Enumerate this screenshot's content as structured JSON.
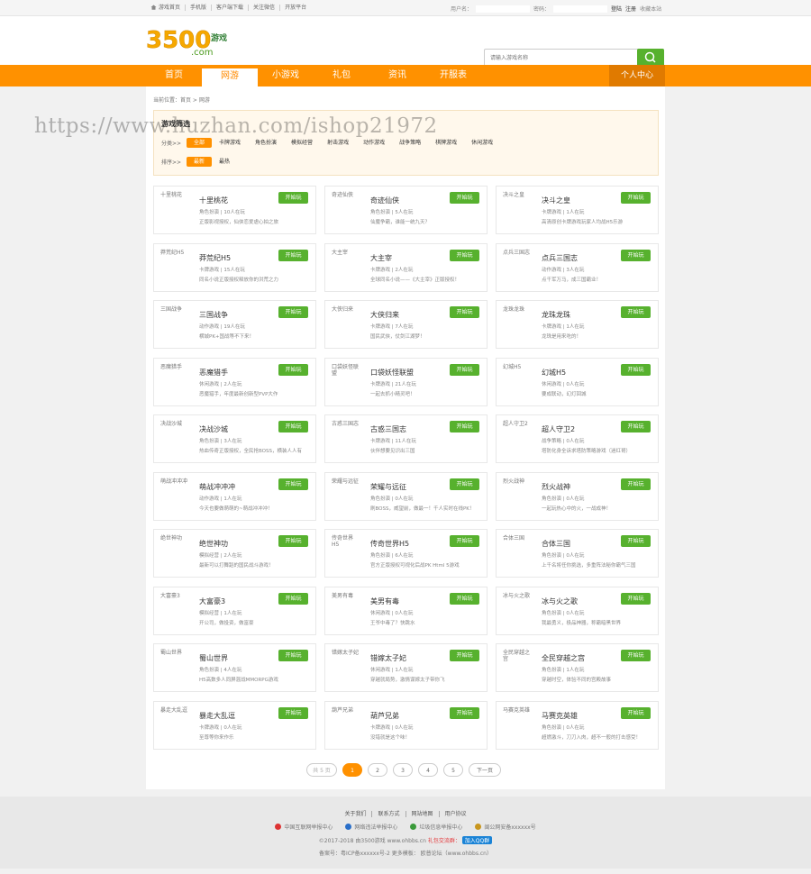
{
  "topbar": {
    "links": [
      "游戏首页",
      "手机版",
      "客户端下载",
      "关注微信",
      "开放平台"
    ],
    "username_label": "用户名：",
    "password_label": "密码：",
    "login": "登陆",
    "register": "注册",
    "favorite": "收藏本站"
  },
  "header": {
    "logo_text": "3500",
    "logo_sub": "游戏",
    "logo_domain": ".com",
    "search_placeholder": "请输入游戏名称"
  },
  "nav": {
    "items": [
      "首页",
      "网游",
      "小游戏",
      "礼包",
      "资讯",
      "开服表"
    ],
    "active_index": 1,
    "personal": "个人中心"
  },
  "breadcrumb": "当前位置：首页 > 网游",
  "filter": {
    "title": "游戏筛选",
    "category_label": "分类>>",
    "categories": [
      "全部",
      "卡牌游戏",
      "角色扮演",
      "模拟经营",
      "射击游戏",
      "动作游戏",
      "战争策略",
      "棋牌游戏",
      "休闲游戏"
    ],
    "sort_label": "排序>>",
    "sorts": [
      "最新",
      "最热"
    ]
  },
  "play_label": "开始玩",
  "games": [
    {
      "name": "十里桃花",
      "meta": "角色扮演 | 10人在玩",
      "desc": "正版影视授权，仙侠恋爱虐心拍之旅"
    },
    {
      "name": "奇迹仙侠",
      "meta": "角色扮演 | 5人在玩",
      "desc": "仙魔争霸，谁能一统九天？"
    },
    {
      "name": "决斗之皇",
      "meta": "卡牌游戏 | 1人在玩",
      "desc": "高清原创卡牌游戏玩家人均战H5乐游"
    },
    {
      "name": "莽荒纪H5",
      "meta": "卡牌游戏 | 15人在玩",
      "desc": "同名小说正版授权释放你的洪荒之力"
    },
    {
      "name": "大主宰",
      "meta": "卡牌游戏 | 2人在玩",
      "desc": "全球同名小说——《大主宰》正版授权！"
    },
    {
      "name": "点兵三国志",
      "meta": "动作游戏 | 3人在玩",
      "desc": "点千军万马，成三国霸业！"
    },
    {
      "name": "三国战争",
      "meta": "动作游戏 | 19人在玩",
      "desc": "横城PK+国战等不下来！"
    },
    {
      "name": "大侠归来",
      "meta": "卡牌游戏 | 7人在玩",
      "desc": "国民武侠，仗剑江湖梦！"
    },
    {
      "name": "龙珠龙珠",
      "meta": "卡牌游戏 | 1人在玩",
      "desc": "龙珠是用来吃的！"
    },
    {
      "name": "恶魔猎手",
      "meta": "休闲游戏 | 2人在玩",
      "desc": "恶魔猎手，年度最新创新型PVP大作"
    },
    {
      "name": "口袋妖怪联盟",
      "meta": "卡牌游戏 | 21人在玩",
      "desc": "一起去抓小精灵吧！"
    },
    {
      "name": "幻城H5",
      "meta": "休闲游戏 | 0人在玩",
      "desc": "要成联动，幻灯回城"
    },
    {
      "name": "决战沙城",
      "meta": "角色扮演 | 3人在玩",
      "desc": "热血传奇正版授权，全民抢BOSS，横装人人有"
    },
    {
      "name": "古惑三国志",
      "meta": "卡牌游戏 | 11人在玩",
      "desc": "伙伴想要见识出三国"
    },
    {
      "name": "超人守卫2",
      "meta": "战争策略 | 0人在玩",
      "desc": "塔防化身全诉求塔防策略游戏（迷红哥）"
    },
    {
      "name": "萌战冲冲冲",
      "meta": "动作游戏 | 1人在玩",
      "desc": "今天也要做萌萌的~萌战冲冲冲！"
    },
    {
      "name": "荣耀与远征",
      "meta": "角色扮演 | 0人在玩",
      "desc": "刷BOSS，威望前，做最一！千人实时在线PK！"
    },
    {
      "name": "烈火战神",
      "meta": "角色扮演 | 0人在玩",
      "desc": "一起玩热心中的火，一战成神！"
    },
    {
      "name": "绝世神功",
      "meta": "模拟经营 | 2人在玩",
      "desc": "最新可以打舞蹈的国民战斗游戏！"
    },
    {
      "name": "传奇世界H5",
      "meta": "角色扮演 | 6人在玩",
      "desc": "官方正版授权可视化后战PK Html 5游戏"
    },
    {
      "name": "合体三国",
      "meta": "角色扮演 | 0人在玩",
      "desc": "上千名将任你挑选，多重阵法秘你霸气三国"
    },
    {
      "name": "大富豪3",
      "meta": "模拟经营 | 1人在玩",
      "desc": "开公司，做投资，做富豪"
    },
    {
      "name": "美男有毒",
      "meta": "休闲游戏 | 0人在玩",
      "desc": "王爷中毒了？快跳水"
    },
    {
      "name": "冰与火之歌",
      "meta": "角色扮演 | 0人在玩",
      "desc": "我最勇义，极品神器，称霸暗黑世界"
    },
    {
      "name": "蜀山世界",
      "meta": "角色扮演 | 4人在玩",
      "desc": "H5高数多人同屏混战MMORPG游戏"
    },
    {
      "name": "错嫁太子妃",
      "meta": "休闲游戏 | 1人在玩",
      "desc": "穿越就局势，激情谋嫁太子带你飞"
    },
    {
      "name": "全民穿越之宫",
      "meta": "角色扮演 | 1人在玩",
      "desc": "穿越时空，体验不同的宫殿故事"
    },
    {
      "name": "暴走大乱逗",
      "meta": "卡牌游戏 | 0人在玩",
      "desc": "至尊等你来作乐"
    },
    {
      "name": "葫芦兄弟",
      "meta": "卡牌游戏 | 0人在玩",
      "desc": "没错就是这个味！"
    },
    {
      "name": "马赛克英雄",
      "meta": "角色扮演 | 0人在玩",
      "desc": "超燃激斗，刀刀入肉，超不一般的打击感受！"
    }
  ],
  "pager": {
    "count": "共 5 页",
    "pages": [
      "1",
      "2",
      "3",
      "4",
      "5"
    ],
    "current": "1",
    "next": "下一页"
  },
  "footer": {
    "links": [
      "关于我们",
      "联系方式",
      "网站地图",
      "用户协议"
    ],
    "badges": [
      "中国互联网举报中心",
      "网络违法举报中心",
      "垃圾信息举报中心",
      "闽公网安备xxxxxx号"
    ],
    "copyright": "©2017-2018  由3500游戏  www.ohbbs.cn",
    "gift_label": "礼包交流群：",
    "qq_button": "加入QQ群",
    "icp": "备案号：粤ICP备xxxxxx号-2   更多模板：  欧普论坛（www.ohbbs.cn）"
  },
  "watermark": "https://www.huzhan.com/ishop21972",
  "colors": {
    "accent": "#ff9100",
    "play_green": "#57b12e",
    "nav_dark": "#e07a00"
  }
}
